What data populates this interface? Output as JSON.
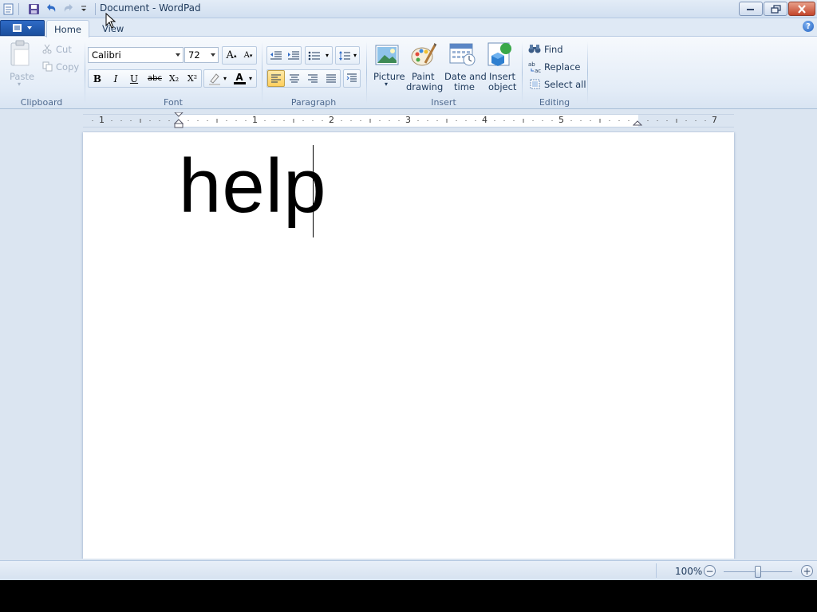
{
  "window": {
    "title": "Document - WordPad"
  },
  "tabs": [
    {
      "label": "Home"
    },
    {
      "label": "View"
    }
  ],
  "clipboard": {
    "paste": "Paste",
    "cut": "Cut",
    "copy": "Copy",
    "group": "Clipboard"
  },
  "font": {
    "name": "Calibri",
    "size": "72",
    "group": "Font",
    "bold": "B",
    "italic": "I",
    "underline": "U",
    "strike": "abc",
    "subscript": "X₂",
    "superscript": "X²",
    "grow": "A",
    "shrink": "A",
    "color_letter": "A"
  },
  "paragraph": {
    "group": "Paragraph"
  },
  "insert": {
    "group": "Insert",
    "picture": "Picture",
    "paint_1": "Paint",
    "paint_2": "drawing",
    "datetime_1": "Date and",
    "datetime_2": "time",
    "object_1": "Insert",
    "object_2": "object"
  },
  "editing": {
    "group": "Editing",
    "find": "Find",
    "replace": "Replace",
    "select_all": "Select all"
  },
  "ruler": {
    "numbers": [
      "1",
      "1",
      "2",
      "3",
      "4",
      "5",
      "7"
    ]
  },
  "document": {
    "text": "help"
  },
  "status": {
    "zoom": "100%",
    "zoom_out": "−",
    "zoom_in": "+"
  },
  "colors": {
    "accent": "#1a4f9e",
    "active_button": "#ffcf5c",
    "font_color": "#000000"
  }
}
